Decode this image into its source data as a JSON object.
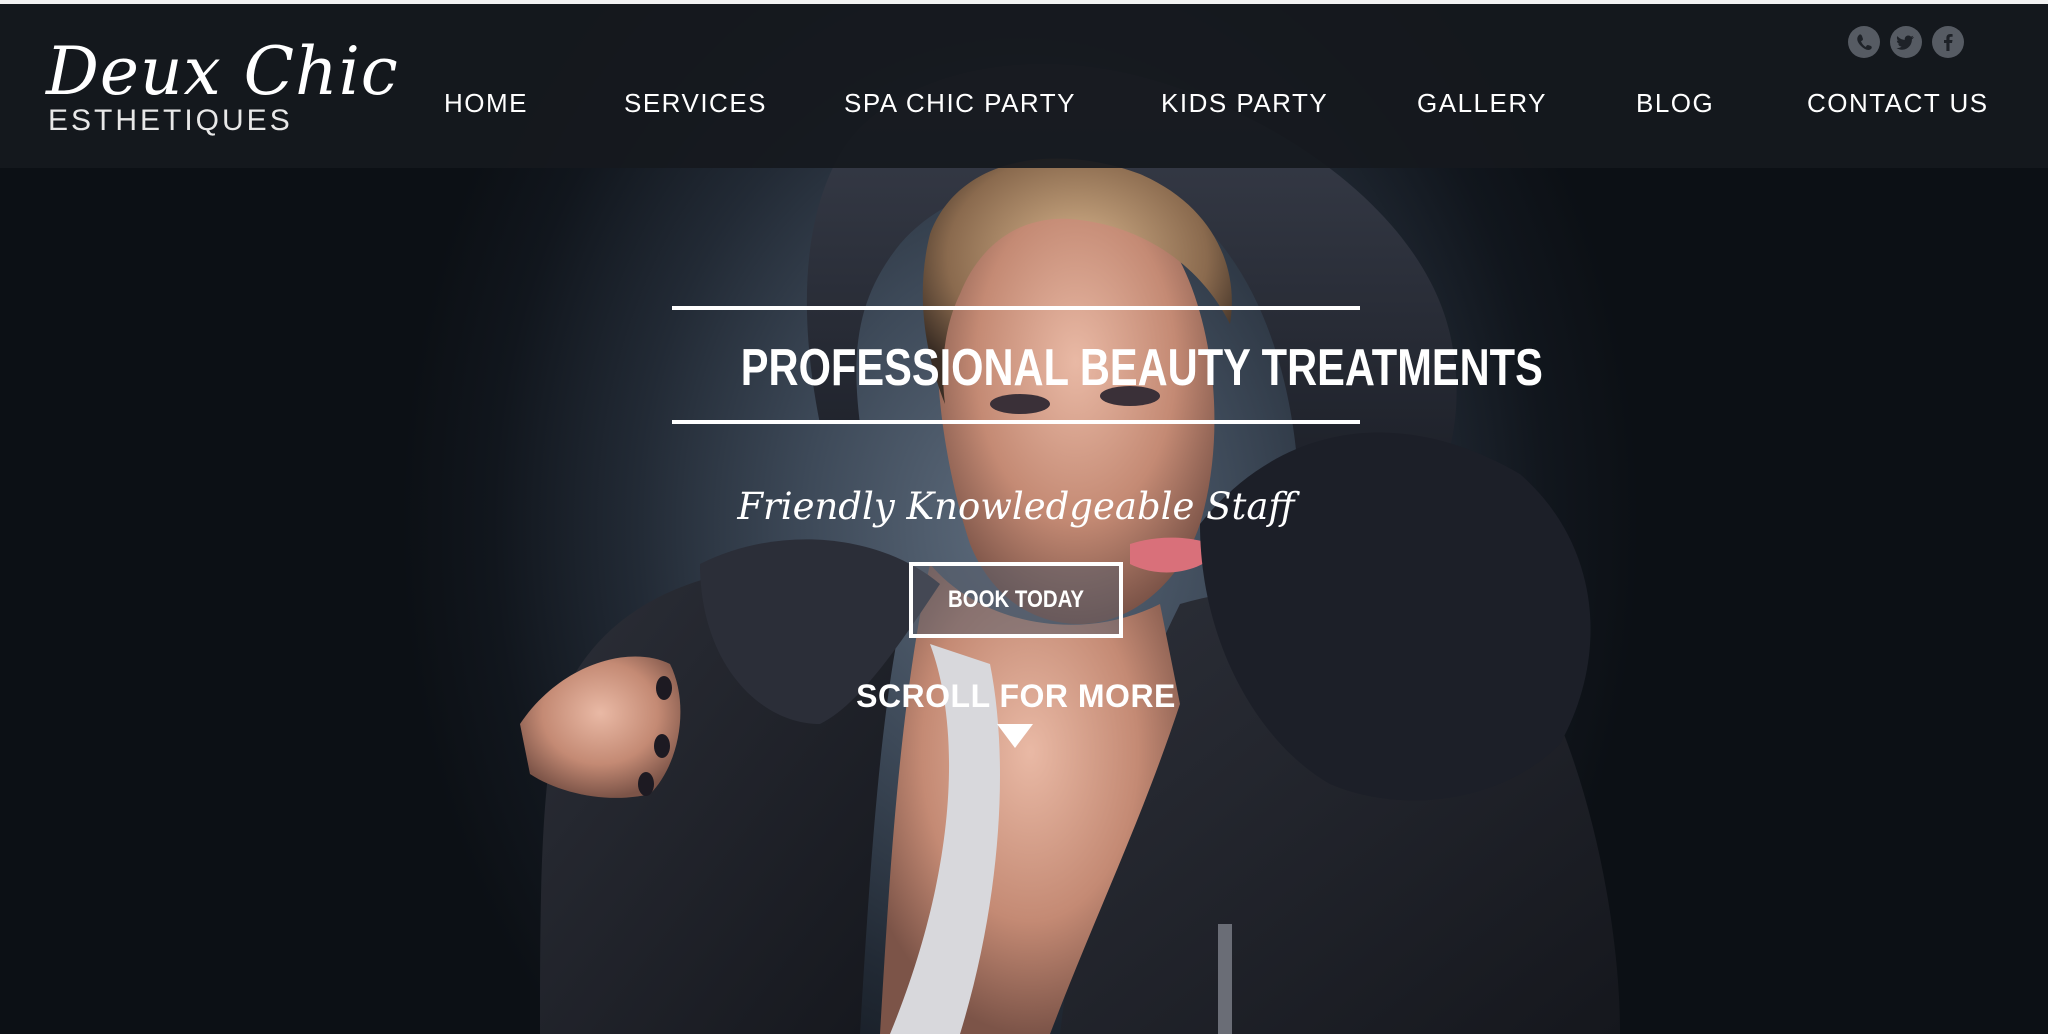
{
  "brand": {
    "logo_script": "Deux Chic",
    "logo_sub": "ESTHETIQUES"
  },
  "nav": {
    "items": [
      {
        "label": "HOME"
      },
      {
        "label": "SERVICES"
      },
      {
        "label": "SPA CHIC PARTY"
      },
      {
        "label": "KIDS PARTY"
      },
      {
        "label": "GALLERY"
      },
      {
        "label": "BLOG"
      },
      {
        "label": "CONTACT US"
      }
    ]
  },
  "social": {
    "icons": [
      "phone-icon",
      "twitter-icon",
      "facebook-icon"
    ],
    "icon_color": "#565b63"
  },
  "hero": {
    "title": "PROFESSIONAL BEAUTY TREATMENTS",
    "subtitle": "Friendly Knowledgeable Staff",
    "cta_label": "BOOK TODAY",
    "scroll_label": "SCROLL FOR MORE"
  },
  "colors": {
    "header_bg": "#16191e",
    "text": "#ffffff",
    "hero_bg": "#11151b"
  }
}
